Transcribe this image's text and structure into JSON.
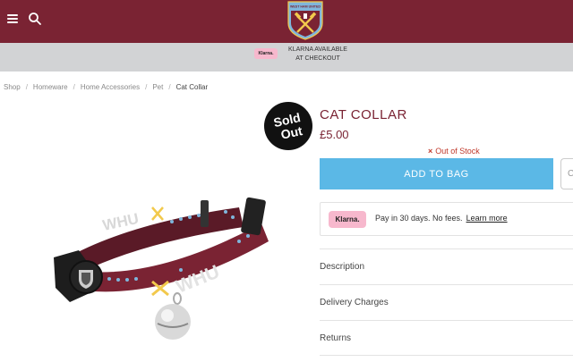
{
  "header": {
    "menu_icon": "hamburger-icon",
    "search_icon": "search-icon",
    "crest_text": "WEST HAM UNITED",
    "bg_color": "#7a2333"
  },
  "promo": {
    "klarna_logo": "Klarna.",
    "line1": "KLARNA AVAILABLE",
    "line2": "AT CHECKOUT"
  },
  "breadcrumb": [
    "Shop",
    "Homeware",
    "Home Accessories",
    "Pet",
    "Cat Collar"
  ],
  "product": {
    "badge_line1": "Sold",
    "badge_line2": "Out",
    "title": "CAT COLLAR",
    "price": "£5.00",
    "stock_icon": "×",
    "stock": "Out of Stock",
    "collar_text": "WHU",
    "accent_color": "#7a2333"
  },
  "actions": {
    "add_to_bag": "ADD TO BAG",
    "add_button_color": "#5bb8e6",
    "wishlist_icon": "C"
  },
  "klarna": {
    "logo": "Klarna.",
    "message": "Pay in 30 days. No fees.",
    "link": "Learn more"
  },
  "accordion": [
    "Description",
    "Delivery Charges",
    "Returns"
  ]
}
